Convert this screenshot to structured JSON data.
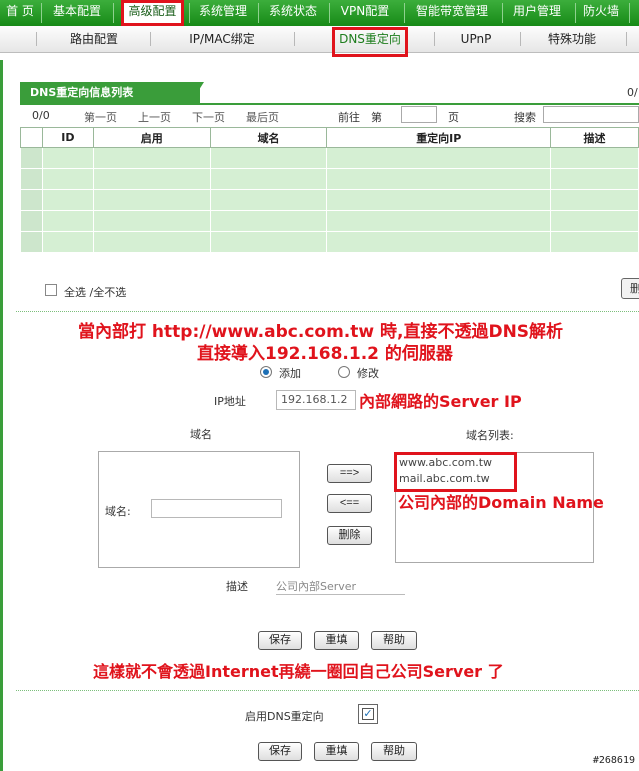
{
  "topnav": {
    "items": [
      "首 页",
      "基本配置",
      "高级配置",
      "系统管理",
      "系统状态",
      "VPN配置",
      "智能带宽管理",
      "用户管理",
      "防火墙"
    ],
    "active_index": 2
  },
  "subnav": {
    "items": [
      "路由配置",
      "IP/MAC绑定",
      "DNS重定向",
      "UPnP",
      "特殊功能"
    ],
    "active_index": 2
  },
  "table": {
    "title": "DNS重定向信息列表",
    "count_right": "0/",
    "count": "0/0",
    "pager": {
      "first": "第一页",
      "prev": "上一页",
      "next": "下一页",
      "last": "最后页",
      "goto": "前往",
      "page_prefix": "第",
      "page_suffix": "页",
      "search": "搜索"
    },
    "headers": [
      "",
      "ID",
      "启用",
      "域名",
      "重定向IP",
      "描述"
    ]
  },
  "select_all_label": "全选 /全不选",
  "delete_partial": "删",
  "annotations": {
    "line1": "當內部打 http://www.abc.com.tw 時,直接不透過DNS解析",
    "line2": "直接導入192.168.1.2 的伺服器",
    "server_ip": "內部網路的Server IP",
    "domain": "公司內部的Domain Name",
    "bottom": "這樣就不會透過Internet再繞一圈回自己公司Server 了"
  },
  "form": {
    "mode_add": "添加",
    "mode_modify": "修改",
    "mode_selected": "add",
    "ip_label": "IP地址",
    "ip_value": "192.168.1.2",
    "domain_header": "域名",
    "domain_list_header": "域名列表:",
    "domain_label": "域名:",
    "domain_value": "",
    "domain_list": [
      "www.abc.com.tw",
      "mail.abc.com.tw"
    ],
    "btn_add": "==>",
    "btn_remove": "<==",
    "btn_delete": "删除",
    "desc_label": "描述",
    "desc_value": "公司內部Server",
    "save": "保存",
    "reset": "重填",
    "help": "帮助"
  },
  "enable": {
    "label": "启用DNS重定向",
    "checked": true,
    "save": "保存",
    "reset": "重填",
    "help": "帮助"
  },
  "watermark": "#268619",
  "colors": {
    "nav_green": "#178a17",
    "row_green": "#d5efd3",
    "annotation_red": "#e0131c"
  }
}
